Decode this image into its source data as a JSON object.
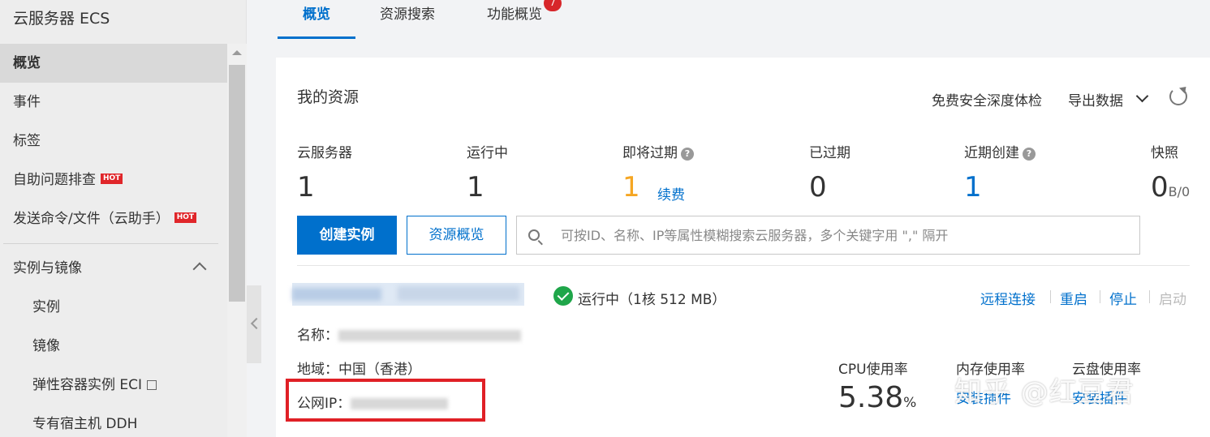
{
  "sidebar": {
    "title": "云服务器 ECS",
    "items": [
      {
        "label": "概览",
        "active": true
      },
      {
        "label": "事件"
      },
      {
        "label": "标签"
      },
      {
        "label": "自助问题排查",
        "badge": "HOT"
      },
      {
        "label": "发送命令/文件（云助手）",
        "badge": "HOT"
      }
    ],
    "section": {
      "label": "实例与镜像",
      "expanded": true
    },
    "sub_items": [
      {
        "label": "实例"
      },
      {
        "label": "镜像"
      },
      {
        "label": "弹性容器实例 ECI",
        "icon": "external-link-icon"
      },
      {
        "label": "专有宿主机 DDH"
      }
    ]
  },
  "tabs": [
    {
      "label": "概览",
      "active": true
    },
    {
      "label": "资源搜索"
    },
    {
      "label": "功能概览",
      "badge": "7"
    }
  ],
  "resources": {
    "title": "我的资源",
    "free_check": "免费安全深度体检",
    "export": "导出数据",
    "stats": [
      {
        "label": "云服务器",
        "value": "1"
      },
      {
        "label": "运行中",
        "value": "1"
      },
      {
        "label": "即将过期",
        "value": "1",
        "help": "?",
        "action": "续费"
      },
      {
        "label": "已过期",
        "value": "0"
      },
      {
        "label": "近期创建",
        "value": "1",
        "help": "?"
      },
      {
        "label": "快照",
        "value": "0",
        "unit": "B/0"
      }
    ],
    "create_button": "创建实例",
    "overview_button": "资源概览",
    "search_placeholder": "可按ID、名称、IP等属性模糊搜索云服务器，多个关键字用 \",\" 隔开"
  },
  "instance": {
    "status": "运行中（1核 512 MB）",
    "actions": [
      "远程连接",
      "重启",
      "停止",
      "启动"
    ],
    "name_label": "名称：",
    "region": "地域：中国（香港）",
    "ip_label": "公网IP：",
    "metrics": {
      "cpu_label": "CPU使用率",
      "cpu_value": "5.38",
      "cpu_unit": "%",
      "mem_label": "内存使用率",
      "mem_action": "安装插件",
      "disk_label": "云盘使用率",
      "disk_action": "安装插件"
    }
  },
  "watermark": "知乎 @红豆君",
  "colors": {
    "accent": "#0070cc",
    "hot": "#e0262a",
    "running": "#1fa64a",
    "warning": "#f5a623",
    "highlight": "#e02026"
  }
}
